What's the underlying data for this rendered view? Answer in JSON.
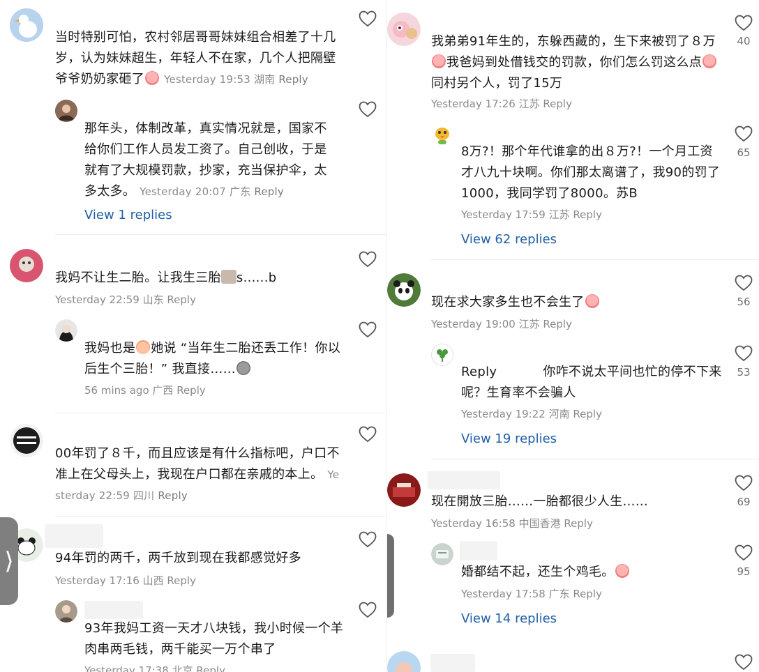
{
  "left": {
    "comments": [
      {
        "text": "当时特别可怕，农村邻居哥哥妹妹组合相差了十几岁，认为妹妹超生，年轻人不在家，几个人把隔壁爷爷奶奶家砸了",
        "time": "Yesterday 19:53",
        "location": "湖南",
        "reply": "Reply",
        "avatar_icon": "goose-avatar"
      },
      {
        "text": "那年头，体制改革，真实情况就是，国家不给你们工作人员发工资了。自己创收，于是就有了大规模罚款，抄家，充当保护伞，太多太多。",
        "time": "Yesterday 20:07",
        "location": "广东",
        "reply": "Reply",
        "view_replies": "View 1 replies"
      },
      {
        "text": "我妈不让生二胎。让我生三胎",
        "text_tail": "s......b",
        "time": "Yesterday 22:59",
        "location": "山东",
        "reply": "Reply"
      },
      {
        "text_a": "我妈也是",
        "text_b": "她说 “当年生二胎还丢工作！你以后生个三胎！” 我直接……",
        "time": "56 mins ago",
        "location": "广西",
        "reply": "Reply"
      },
      {
        "text": "00年罚了８千，而且应该是有什么指标吧，户口不准上在父母头上，我现在户口都在亲戚的本上。",
        "time": "Yesterday 22:59",
        "location": "四川",
        "reply": "Reply"
      },
      {
        "text": "94年罚的两千，两千放到现在我都感觉好多",
        "time": "Yesterday 17:16",
        "location": "山西",
        "reply": "Reply"
      },
      {
        "text": "93年我妈工资一天才八块钱，我小时候一个羊肉串两毛钱，两千能买一万个串了",
        "time": "Yesterday 17:38",
        "location": "北京",
        "reply": "Reply"
      }
    ]
  },
  "right": {
    "comments": [
      {
        "text_a": "我弟弟91年生的，东躲西藏的，生下来被罚了８万",
        "text_b": "我爸妈到处借钱交的罚款，你们怎么罚这么点",
        "text_c": "同村另个人，罚了15万",
        "time": "Yesterday 17:26",
        "location": "江苏",
        "reply": "Reply",
        "likes": "40"
      },
      {
        "text": "8万?！那个年代谁拿的出８万?！一个月工资才八九十块啊。你们那太离谱了，我90的罚了1000，我同学罚了8000。苏B",
        "time": "Yesterday 17:59",
        "location": "江苏",
        "reply": "Reply",
        "likes": "65",
        "view_replies": "View 62 replies"
      },
      {
        "text": "现在求大家多生也不会生了",
        "time": "Yesterday 19:00",
        "location": "江苏",
        "reply": "Reply",
        "likes": "56"
      },
      {
        "reply_prefix": "Reply",
        "text": "你咋不说太平间也忙的停不下来呢？生育率不会骗人",
        "time": "Yesterday 19:22",
        "location": "河南",
        "reply": "Reply",
        "likes": "53",
        "view_replies": "View 19 replies"
      },
      {
        "text": "现在開放三胎……一胎都很少人生……",
        "time": "Yesterday 16:58",
        "location": "中国香港",
        "reply": "Reply",
        "likes": "69"
      },
      {
        "text": "婚都结不起，还生个鸡毛。",
        "time": "Yesterday 17:58",
        "location": "广东",
        "reply": "Reply",
        "likes": "95",
        "view_replies": "View 14 replies"
      }
    ]
  },
  "back_tab_glyph": "⟩",
  "colors": {
    "link": "#1f5fa6",
    "meta": "#8a8a8a",
    "text": "#1a1a1a"
  }
}
